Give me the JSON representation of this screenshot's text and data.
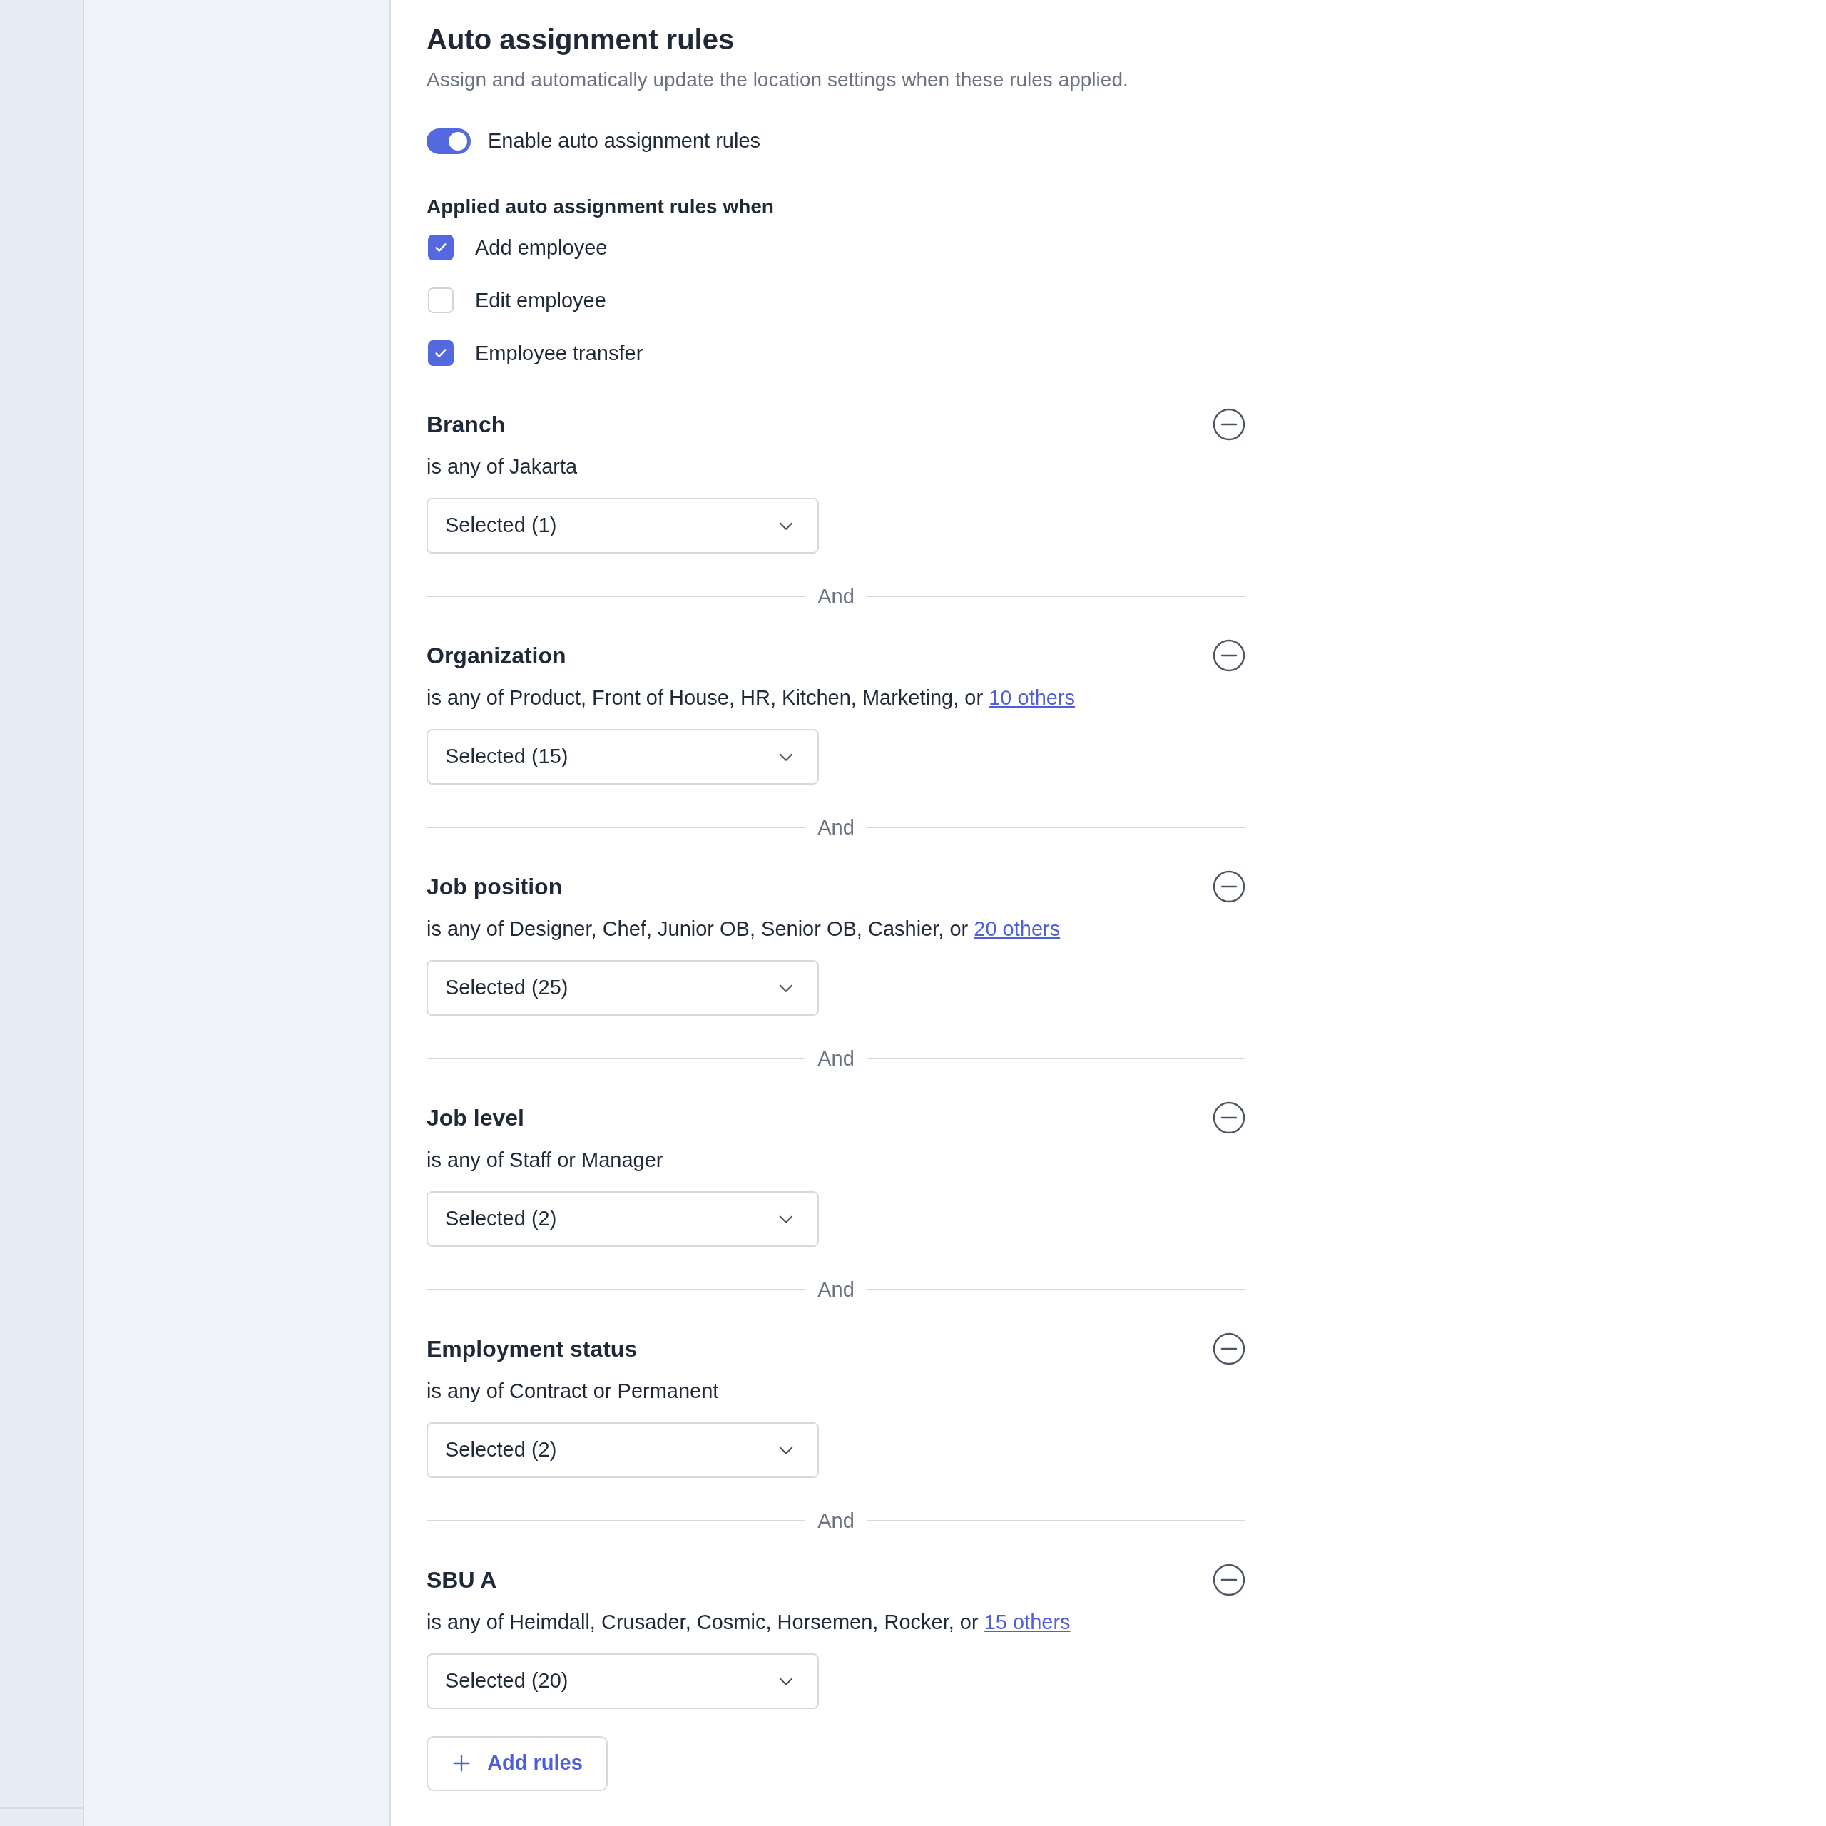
{
  "title": "Auto assignment rules",
  "subtitle": "Assign and automatically update the location settings when these rules applied.",
  "toggle": {
    "label": "Enable auto assignment rules",
    "on": true
  },
  "conditions": {
    "heading": "Applied auto assignment rules when",
    "options": [
      {
        "label": "Add employee",
        "checked": true
      },
      {
        "label": "Edit employee",
        "checked": false
      },
      {
        "label": "Employee transfer",
        "checked": true
      }
    ]
  },
  "rules": [
    {
      "title": "Branch",
      "description": "is any of Jakarta",
      "dropdown": "Selected (1)"
    },
    {
      "separator": "And",
      "title": "Organization",
      "description": "is any of Product, Front of House, HR, Kitchen, Marketing, or",
      "link": "10 others",
      "dropdown": "Selected (15)"
    },
    {
      "separator": "And",
      "title": "Job position",
      "description": "is any of Designer, Chef, Junior OB, Senior OB, Cashier, or",
      "link": "20 others",
      "dropdown": "Selected (25)"
    },
    {
      "separator": "And",
      "title": "Job level",
      "description": "is any of Staff or Manager",
      "dropdown": "Selected (2)"
    },
    {
      "separator": "And",
      "title": "Employment status",
      "description": "is any of Contract or Permanent",
      "dropdown": "Selected (2)"
    },
    {
      "separator": "And",
      "title": "SBU A",
      "description": "is any of Heimdall, Crusader, Cosmic, Horsemen, Rocker, or",
      "link": "15 others",
      "dropdown": "Selected (20)"
    }
  ],
  "add_button": "Add rules"
}
